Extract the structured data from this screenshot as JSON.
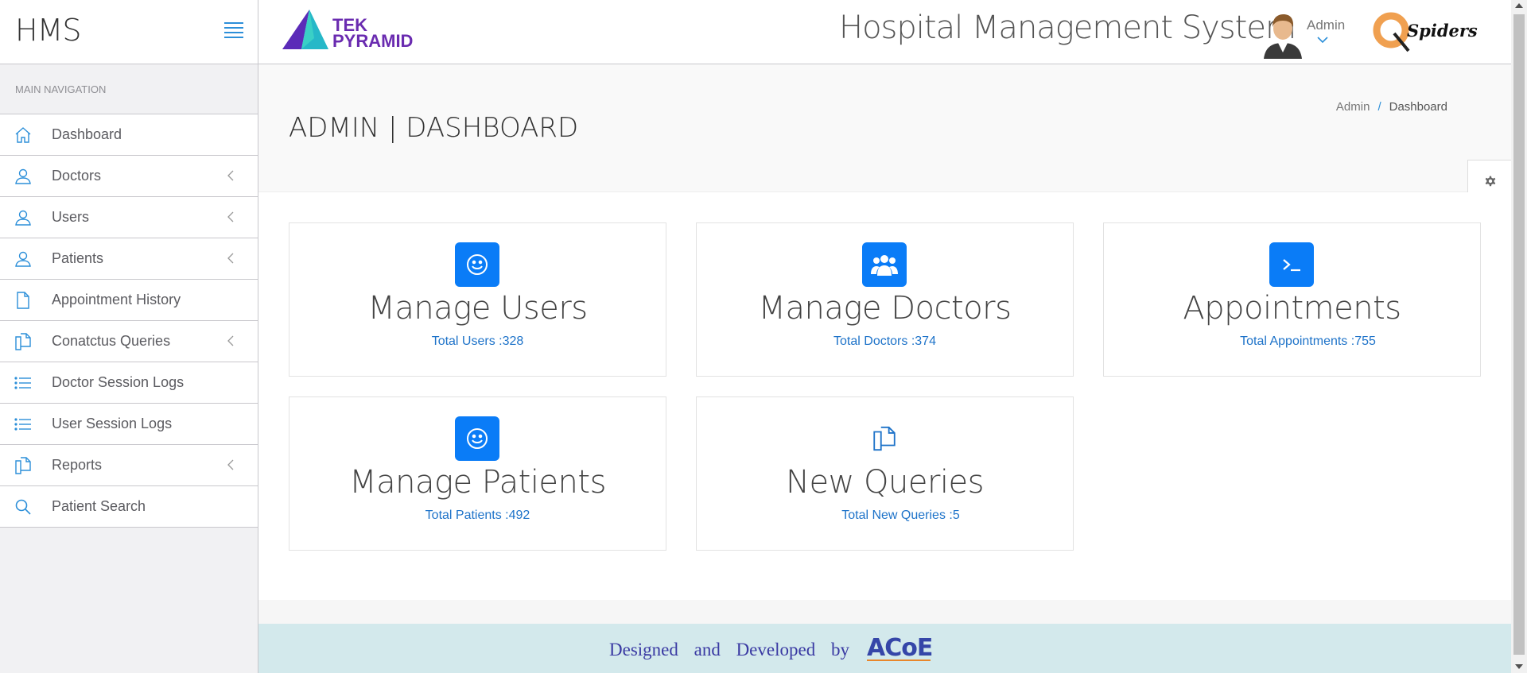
{
  "sidebar": {
    "app_name": "HMS",
    "section_heading": "MAIN NAVIGATION",
    "items": [
      {
        "label": "Dashboard",
        "icon": "home-icon",
        "has_arrow": false
      },
      {
        "label": "Doctors",
        "icon": "user-icon",
        "has_arrow": true
      },
      {
        "label": "Users",
        "icon": "user-icon",
        "has_arrow": true
      },
      {
        "label": "Patients",
        "icon": "user-icon",
        "has_arrow": true
      },
      {
        "label": "Appointment History",
        "icon": "file-icon",
        "has_arrow": false
      },
      {
        "label": "Conatctus Queries",
        "icon": "files-icon",
        "has_arrow": true
      },
      {
        "label": "Doctor Session Logs",
        "icon": "list-icon",
        "has_arrow": false
      },
      {
        "label": "User Session Logs",
        "icon": "list-icon",
        "has_arrow": false
      },
      {
        "label": "Reports",
        "icon": "files-icon",
        "has_arrow": true
      },
      {
        "label": "Patient Search",
        "icon": "search-icon",
        "has_arrow": false
      }
    ]
  },
  "header": {
    "logo_line1": "TEK",
    "logo_line2": "PYRAMID",
    "system_title": "Hospital Management System",
    "user_name": "Admin",
    "partner_logo": "Spiders"
  },
  "page": {
    "title": "ADMIN | DASHBOARD",
    "breadcrumb": [
      "Admin",
      "Dashboard"
    ]
  },
  "panels": [
    {
      "title": "Manage Users",
      "link": "Total Users :328",
      "icon": "smile-icon"
    },
    {
      "title": "Manage Doctors",
      "link": "Total Doctors :374",
      "icon": "users-icon"
    },
    {
      "title": "Appointments",
      "link": "Total Appointments :755",
      "icon": "terminal-icon"
    },
    {
      "title": "Manage Patients",
      "link": "Total Patients :492",
      "icon": "smile-icon"
    },
    {
      "title": "New Queries",
      "link": "Total New Queries :5",
      "icon": "files-icon"
    }
  ],
  "footer": {
    "text": "Designed and Developed by",
    "logo": "ACoE"
  },
  "colors": {
    "accent": "#0a7cf7",
    "link": "#1e73c9",
    "footer_bg": "#d3e9ec",
    "logo_purple": "#6a2bb0"
  }
}
